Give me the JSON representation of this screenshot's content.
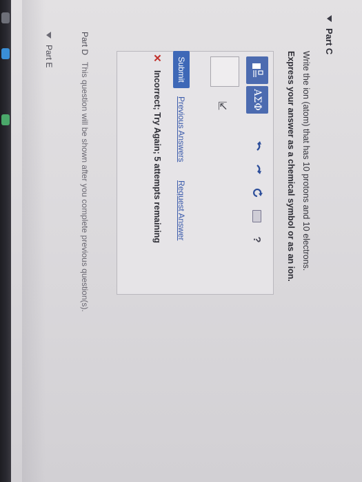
{
  "part_c": {
    "title": "Part C",
    "question_line1": "Write the ion (atom) that has 10 protons and 10 electrons.",
    "question_line2": "Express your answer as a chemical symbol or as an ion."
  },
  "toolbar": {
    "greek_label": "ΑΣΦ",
    "help_label": "?"
  },
  "actions": {
    "submit_label": "Submit",
    "previous_answers_label": "Previous Answers",
    "request_answer_label": "Request Answer"
  },
  "feedback": {
    "mark": "✕",
    "text": "Incorrect; Try Again; 5 attempts remaining",
    "color": "#c1302b"
  },
  "part_d": {
    "label": "Part D",
    "text": "This question will be shown after you complete previous question(s)."
  },
  "part_e": {
    "title": "Part E"
  },
  "colors": {
    "accent": "#3e68b7",
    "toolbar_button": "#4c6bb0"
  }
}
